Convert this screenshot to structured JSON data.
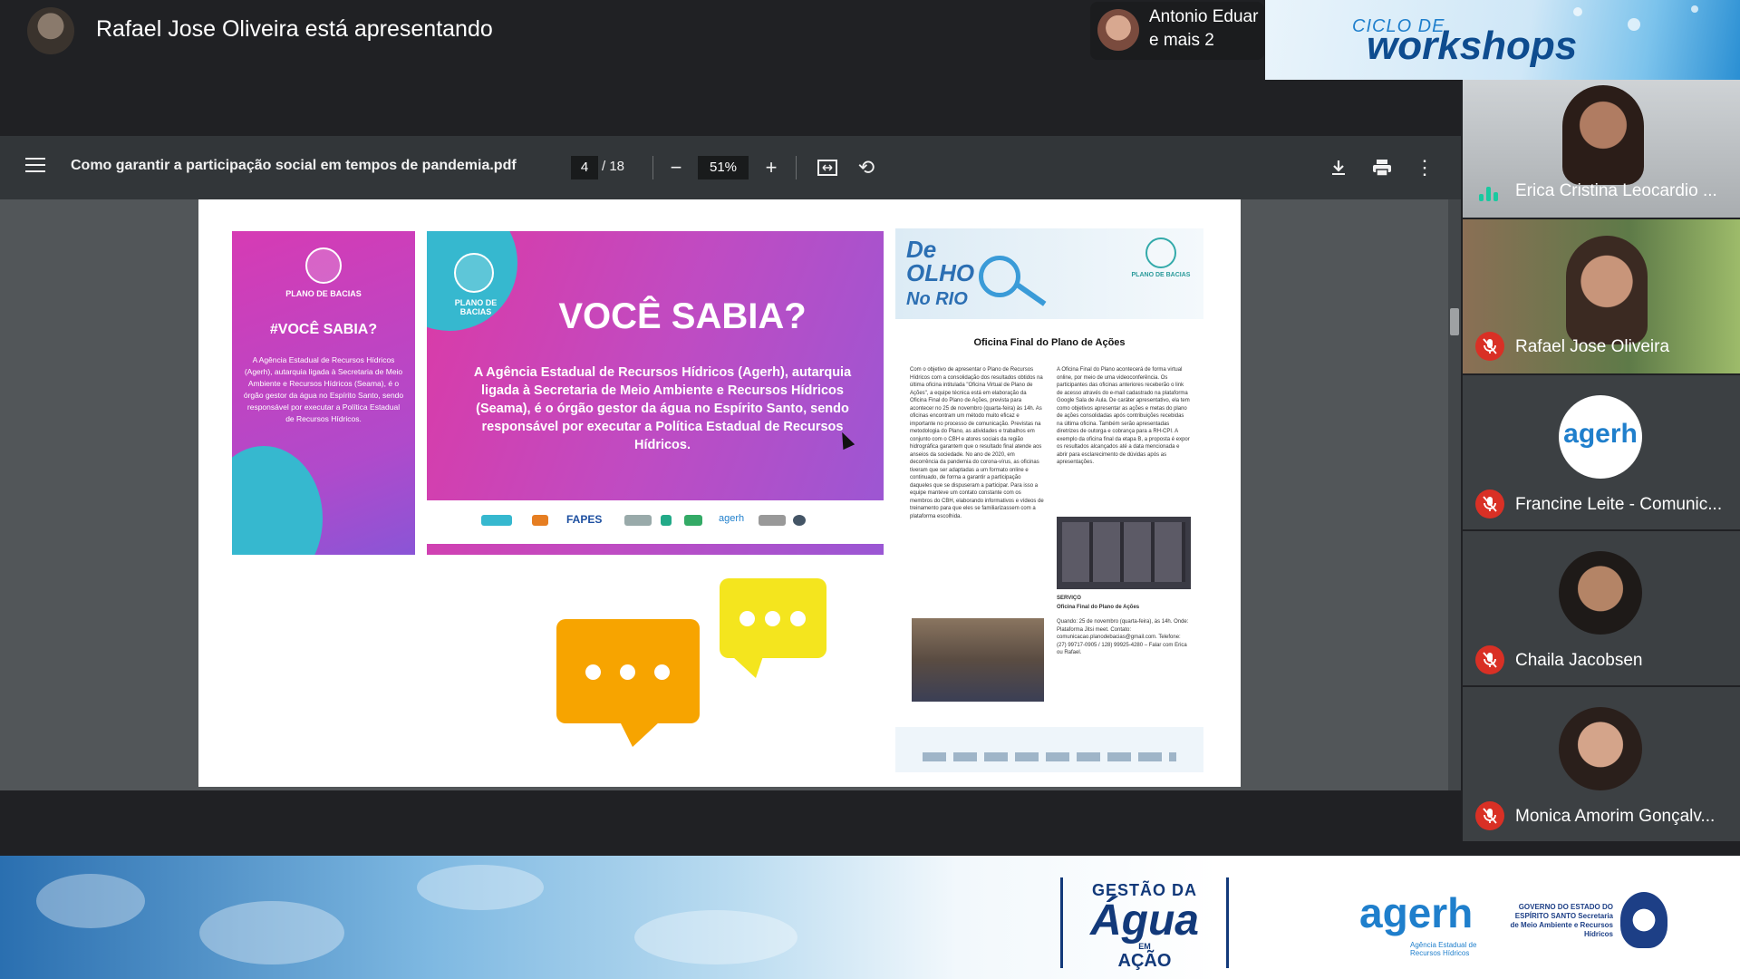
{
  "presenter": {
    "text": "Rafael Jose Oliveira está apresentando",
    "others_line1": "Antonio Eduar",
    "others_line2": "e mais 2"
  },
  "workshop_banner": {
    "small": "CICLO DE",
    "big": "workshops"
  },
  "pdf": {
    "filename": "Como garantir a participação social em tempos de pandemia.pdf",
    "current_page": "4",
    "total_pages": "/ 18",
    "zoom": "51%"
  },
  "page_content": {
    "small_poster": {
      "brand": "PLANO DE BACIAS",
      "heading": "#VOCÊ SABIA?",
      "body": "A Agência Estadual de Recursos Hídricos (Agerh), autarquia ligada à Secretaria de Meio Ambiente e Recursos Hídricos (Seama), é o órgão gestor da água no Espírito Santo, sendo responsável por executar a Política Estadual de Recursos Hídricos."
    },
    "big_poster": {
      "brand": "PLANO DE BACIAS",
      "heading": "VOCÊ SABIA?",
      "body": "A Agência Estadual de Recursos Hídricos (Agerh), autarquia ligada à Secretaria de Meio Ambiente e Recursos Hídricos (Seama), é o órgão gestor da água no Espírito Santo, sendo responsável por executar a Política Estadual de Recursos Hídricos.",
      "footer_logos": [
        "FAPES",
        "agerh"
      ]
    },
    "newsletter": {
      "logo_line1": "De",
      "logo_line2": "OLHO",
      "logo_line3": "No RIO",
      "brand": "PLANO DE BACIAS",
      "title": "Oficina Final do Plano de Ações",
      "col1": "Com o objetivo de apresentar o Plano de Recursos Hídricos com a consolidação dos resultados obtidos na última oficina intitulada \"Oficina Virtual de Plano de Ações\", a equipe técnica está em elaboração da Oficina Final do Plano de Ações, prevista para acontecer no 25 de novembro (quarta-feira) às 14h. As oficinas encontram um método muito eficaz e importante no processo de comunicação. Previstas na metodologia do Plano, as atividades e trabalhos em conjunto com o CBH e atores sociais da região hidrográfica garantem que o resultado final atende aos anseios da sociedade. No ano de 2020, em decorrência da pandemia do corona-vírus, as oficinas tiveram que ser adaptadas a um formato online e continuado, de forma a garantir a participação daqueles que se dispuseram a participar. Para isso a equipe manteve um contato constante com os membros do CBH, elaborando informativos e vídeos de treinamento para que eles se familiarizassem com a plataforma escolhida.",
      "col2": "A Oficina Final do Plano acontecerá de forma virtual online, por meio de uma videoconferência. Os participantes das oficinas anteriores receberão o link de acesso através do e-mail cadastrado na plataforma Google Sala de Aula. De caráter apresentativo, ela tem como objetivos apresentar as ações e metas do plano de ações consolidadas após contribuições recebidas na última oficina. Também serão apresentadas diretrizes de outorga e cobrança para a RH-CPI. A exemplo da oficina final da etapa B, a proposta é expor os resultados alcançados até a data mencionada e abrir para esclarecimento de dúvidas após as apresentações.",
      "service_heading": "SERVIÇO",
      "service_title": "Oficina Final do Plano de Ações",
      "service_body": "Quando: 25 de novembro (quarta-feira), às 14h. Onde: Plataforma Jitsi meet. Contato: comunicacao.planodebacias@gmail.com. Telefone: (27) 99717-0905 / 128) 99925-4280 – Falar com Erica ou Rafael."
    }
  },
  "participants": [
    {
      "name": "Erica Cristina Leocardio ...",
      "status": "speaking"
    },
    {
      "name": "Rafael Jose Oliveira",
      "status": "muted"
    },
    {
      "name": "Francine Leite - Comunic...",
      "status": "muted",
      "avatar_text": "agerh"
    },
    {
      "name": "Chaila Jacobsen",
      "status": "muted"
    },
    {
      "name": "Monica Amorim Gonçalv...",
      "status": "muted"
    }
  ],
  "bottom_banner": {
    "gestao_top": "GESTÃO DA",
    "gestao_mid": "Água",
    "gestao_em": "EM",
    "gestao_bot": "AÇÃO",
    "agerh": "agerh",
    "agerh_sub": "Agência Estadual de Recursos Hídricos",
    "gov_text": "GOVERNO DO ESTADO DO ESPÍRITO SANTO Secretaria de Meio Ambiente e Recursos Hídricos"
  },
  "colors": {
    "speaking": "#1ac9a0",
    "muted": "#d93025",
    "poster_magenta": "#d63bb4",
    "poster_teal": "#36b8cf",
    "bubble_orange": "#f7a400",
    "bubble_yellow": "#f4e51e"
  },
  "icons": {
    "menu": "hamburger-icon",
    "zoom_out": "minus-icon",
    "zoom_in": "plus-icon",
    "fit": "fit-page-icon",
    "rotate": "rotate-icon",
    "download": "download-icon",
    "print": "print-icon",
    "more": "more-vert-icon",
    "mic_off": "mic-off-icon",
    "speaking": "audio-level-icon"
  }
}
